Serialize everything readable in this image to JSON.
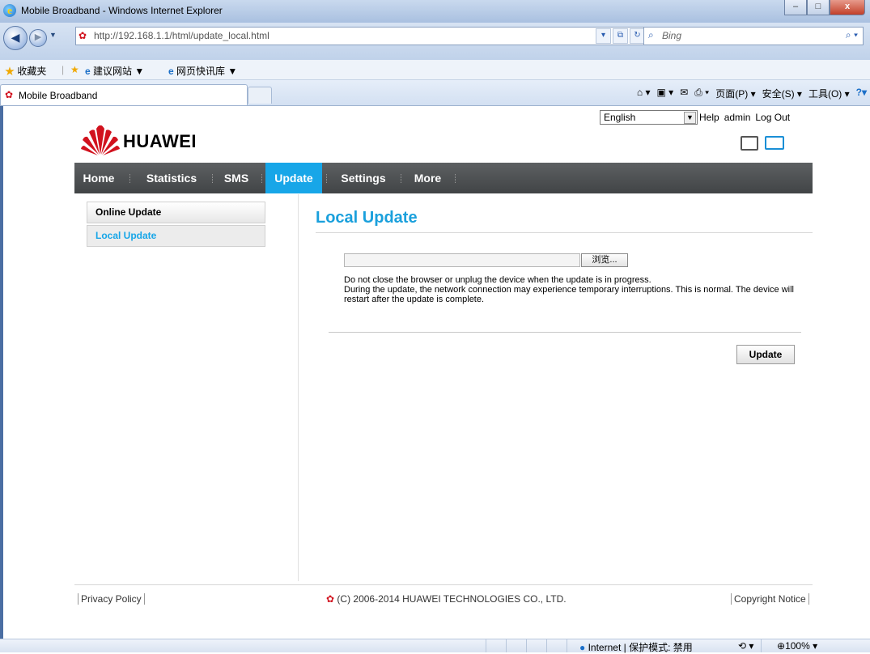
{
  "window": {
    "title": "Mobile Broadband - Windows Internet Explorer",
    "minimize": "–",
    "maximize": "□",
    "close": "x"
  },
  "address": {
    "url": "http://192.168.1.1/html/update_local.html",
    "search_placeholder": "Bing"
  },
  "favorites_bar": {
    "favorites": "收藏夹",
    "suggested": "建议网站 ▼",
    "webslices": "网页快讯库 ▼"
  },
  "tab": {
    "label": "Mobile Broadband"
  },
  "command_bar": {
    "page": "页面(P) ▾",
    "safety": "安全(S) ▾",
    "tools": "工具(O) ▾",
    "help": "?▾"
  },
  "header": {
    "language": "English",
    "help": "Help",
    "user": "admin",
    "logout": "Log Out",
    "brand": "HUAWEI"
  },
  "menu": [
    "Home",
    "Statistics",
    "SMS",
    "Update",
    "Settings",
    "More"
  ],
  "menu_active": "Update",
  "sidebar": {
    "items": [
      {
        "label": "Online Update"
      },
      {
        "label": "Local Update"
      }
    ]
  },
  "content": {
    "title": "Local Update",
    "browse_label": "浏览...",
    "note_line1": "Do not close the browser or unplug the device when the update is in progress.",
    "note_line2": "During the update, the network connection may experience temporary interruptions. This is normal. The device will restart after the update is complete.",
    "update_button": "Update"
  },
  "footer": {
    "privacy": "Privacy Policy",
    "copyright": "(C) 2006-2014 HUAWEI TECHNOLOGIES CO., LTD.",
    "notice": "Copyright Notice"
  },
  "status": {
    "zone": "Internet | 保护模式: 禁用",
    "zoom": "100%"
  },
  "colors": {
    "accent": "#17a6e8",
    "menu_bg": "#4a4d50",
    "brand_red": "#d1121e"
  }
}
